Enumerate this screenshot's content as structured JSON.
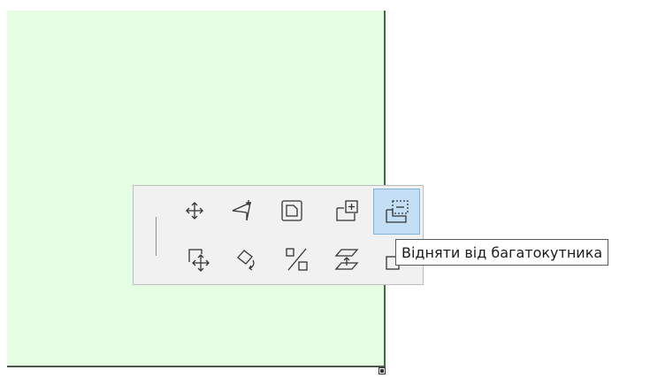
{
  "pet_palette": {
    "row1": [
      {
        "icon": "move-icon",
        "name": "move-button"
      },
      {
        "icon": "drag-node-icon",
        "name": "drag-node-button"
      },
      {
        "icon": "offset-edge-icon",
        "name": "offset-edge-button"
      },
      {
        "icon": "add-to-polygon-icon",
        "name": "add-to-polygon-button"
      },
      {
        "icon": "subtract-from-polygon-icon",
        "name": "subtract-from-polygon-button",
        "active": true
      }
    ],
    "row2": [
      {
        "icon": "drag-copy-icon",
        "name": "drag-copy-button"
      },
      {
        "icon": "rotate-icon",
        "name": "rotate-button"
      },
      {
        "icon": "resize-icon",
        "name": "resize-button"
      },
      {
        "icon": "elevate-icon",
        "name": "elevate-button"
      },
      {
        "icon": "more-icon",
        "name": "more-button"
      }
    ]
  },
  "tooltip": {
    "text": "Відняти від багатокутника"
  },
  "colors": {
    "polygon_fill": "#e5fde3",
    "polygon_edge": "#3f6b3f",
    "active_button": "#c4dff5",
    "palette_bg": "#f1f1f1"
  }
}
